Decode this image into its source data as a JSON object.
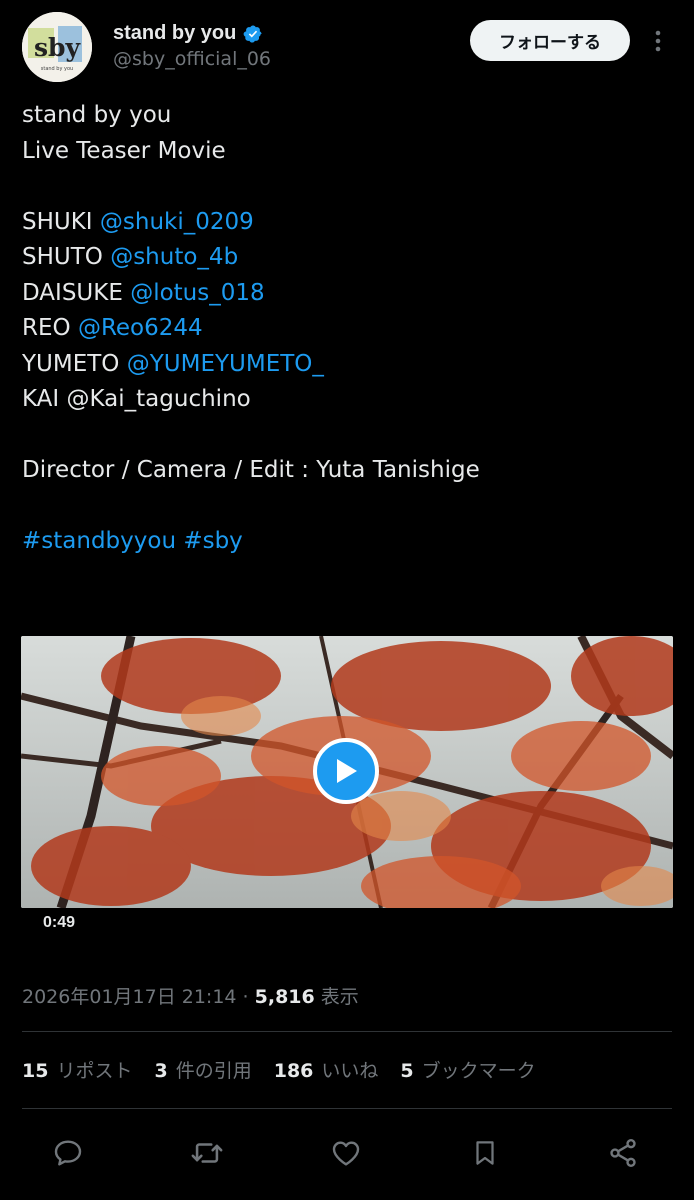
{
  "author": {
    "display_name": "stand by you",
    "handle": "@sby_official_06",
    "avatar_text": "sby",
    "avatar_small_text": "stand by you"
  },
  "follow_button": "フォローする",
  "tweet": {
    "lines": [
      {
        "parts": [
          {
            "text": "stand by you",
            "type": "text"
          }
        ]
      },
      {
        "parts": [
          {
            "text": "Live Teaser Movie",
            "type": "text"
          }
        ]
      },
      {
        "parts": []
      },
      {
        "parts": [
          {
            "text": "SHUKI ",
            "type": "text"
          },
          {
            "text": "@shuki_0209",
            "type": "mention"
          }
        ]
      },
      {
        "parts": [
          {
            "text": "SHUTO ",
            "type": "text"
          },
          {
            "text": "@shuto_4b",
            "type": "mention"
          }
        ]
      },
      {
        "parts": [
          {
            "text": "DAISUKE ",
            "type": "text"
          },
          {
            "text": "@lotus_018",
            "type": "mention"
          }
        ]
      },
      {
        "parts": [
          {
            "text": "REO ",
            "type": "text"
          },
          {
            "text": "@Reo6244",
            "type": "mention"
          }
        ]
      },
      {
        "parts": [
          {
            "text": "YUMETO ",
            "type": "text"
          },
          {
            "text": "@YUMEYUMETO_",
            "type": "mention"
          }
        ]
      },
      {
        "parts": [
          {
            "text": "KAI @Kai_taguchino",
            "type": "text"
          }
        ]
      },
      {
        "parts": []
      },
      {
        "parts": [
          {
            "text": "Director / Camera / Edit : Yuta Tanishige",
            "type": "text"
          }
        ]
      },
      {
        "parts": []
      },
      {
        "parts": [
          {
            "text": "#standbyyou",
            "type": "hashtag"
          },
          {
            "text": " ",
            "type": "text"
          },
          {
            "text": "#sby",
            "type": "hashtag"
          }
        ]
      }
    ]
  },
  "video": {
    "duration": "0:49",
    "play_icon": "play-icon"
  },
  "meta": {
    "timestamp": "2026年01月17日 21:14",
    "separator": " · ",
    "views_count": "5,816",
    "views_label": " 表示"
  },
  "stats": {
    "reposts": {
      "count": "15",
      "label": "リポスト"
    },
    "quotes": {
      "count": "3",
      "label": "件の引用"
    },
    "likes": {
      "count": "186",
      "label": "いいね"
    },
    "bookmarks": {
      "count": "5",
      "label": "ブックマーク"
    }
  },
  "actions": [
    "reply-icon",
    "repost-icon",
    "like-icon",
    "bookmark-icon",
    "share-icon"
  ],
  "colors": {
    "background": "#000000",
    "text": "#e7e9ea",
    "secondary": "#71767b",
    "link": "#1d9bf0",
    "verified": "#1d9bf0",
    "button_bg": "#eff3f4"
  }
}
